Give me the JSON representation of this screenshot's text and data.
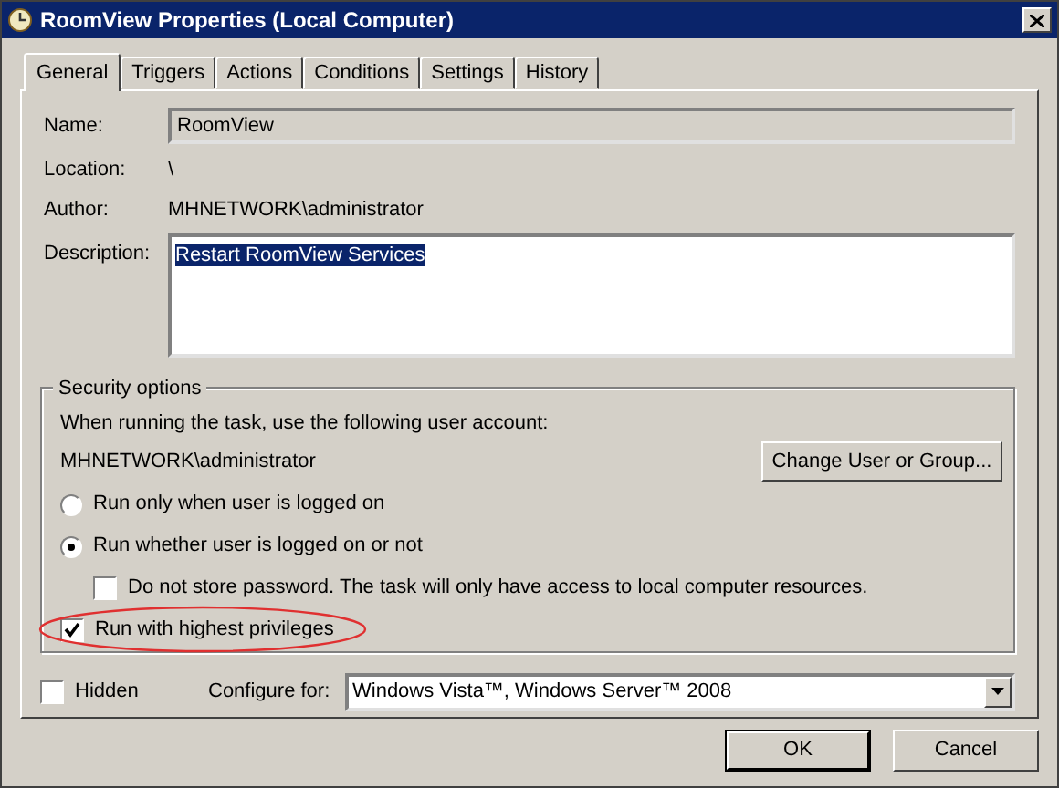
{
  "window": {
    "title": "RoomView Properties (Local Computer)"
  },
  "tabs": [
    {
      "label": "General",
      "selected": true
    },
    {
      "label": "Triggers",
      "selected": false
    },
    {
      "label": "Actions",
      "selected": false
    },
    {
      "label": "Conditions",
      "selected": false
    },
    {
      "label": "Settings",
      "selected": false
    },
    {
      "label": "History",
      "selected": false
    }
  ],
  "name": {
    "label": "Name:",
    "value": "RoomView"
  },
  "location": {
    "label": "Location:",
    "value": "\\"
  },
  "author": {
    "label": "Author:",
    "value": "MHNETWORK\\administrator"
  },
  "description": {
    "label": "Description:",
    "value": "Restart RoomView Services",
    "selected": true
  },
  "security": {
    "title": "Security options",
    "prompt": "When running the task, use the following user account:",
    "account": "MHNETWORK\\administrator",
    "change_button": "Change User or Group...",
    "options": [
      {
        "kind": "radio",
        "label": "Run only when user is logged on",
        "checked": false
      },
      {
        "kind": "radio",
        "label": "Run whether user is logged on or not",
        "checked": true,
        "children": [
          {
            "kind": "checkbox",
            "label": "Do not store password.  The task will only have access to local computer resources.",
            "checked": false
          }
        ]
      },
      {
        "kind": "checkbox",
        "label": "Run with highest privileges",
        "checked": true,
        "highlighted": true
      }
    ]
  },
  "hidden": {
    "label": "Hidden",
    "checked": false
  },
  "configure": {
    "label": "Configure for:",
    "value": "Windows Vista™, Windows Server™ 2008"
  },
  "buttons": [
    {
      "label": "OK",
      "default": true
    },
    {
      "label": "Cancel",
      "default": false
    }
  ]
}
